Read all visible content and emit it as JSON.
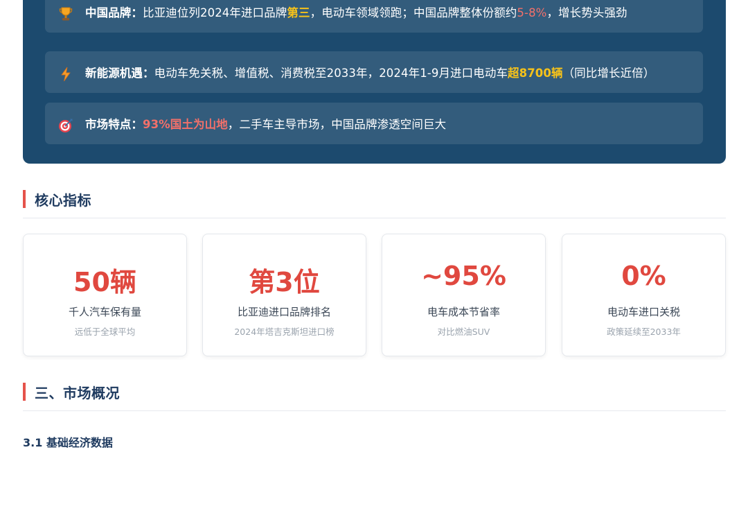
{
  "summary": {
    "rows": [
      {
        "icon": "trophy-icon",
        "label": "中国品牌：",
        "parts": [
          {
            "text": "比亚迪位列2024年进口品牌",
            "style": "plain"
          },
          {
            "text": "第三",
            "style": "yellow"
          },
          {
            "text": "，电动车领域领跑；中国品牌整体份额约",
            "style": "plain"
          },
          {
            "text": "5-8%",
            "style": "red"
          },
          {
            "text": "，增长势头强劲",
            "style": "plain"
          }
        ]
      },
      {
        "icon": "lightning-icon",
        "label": "新能源机遇：",
        "parts": [
          {
            "text": "电动车免关税、增值税、消费税至2033年，2024年1-9月进口电动车",
            "style": "plain"
          },
          {
            "text": "超8700辆",
            "style": "yellow"
          },
          {
            "text": "（同比增长近倍）",
            "style": "plain"
          }
        ]
      },
      {
        "icon": "target-icon",
        "label": "市场特点：",
        "parts": [
          {
            "text": "93%国土为山地",
            "style": "red-bold"
          },
          {
            "text": "，二手车主导市场，中国品牌渗透空间巨大",
            "style": "plain"
          }
        ]
      }
    ]
  },
  "core_metrics": {
    "heading": "核心指标",
    "cards": [
      {
        "value": "50辆",
        "title": "千人汽车保有量",
        "note": "远低于全球平均"
      },
      {
        "value": "第3位",
        "title": "比亚迪进口品牌排名",
        "note": "2024年塔吉克斯坦进口榜"
      },
      {
        "value": "~95%",
        "title": "电车成本节省率",
        "note": "对比燃油SUV"
      },
      {
        "value": "0%",
        "title": "电动车进口关税",
        "note": "政策延续至2033年"
      }
    ]
  },
  "market_overview": {
    "heading": "三、市场概况",
    "sub_heading": "3.1 基础经济数据"
  },
  "colors": {
    "panel_bg": "#1c4a6e",
    "accent_red": "#e0483f",
    "highlight_yellow": "#f6c21a",
    "highlight_red": "#f2706a"
  }
}
